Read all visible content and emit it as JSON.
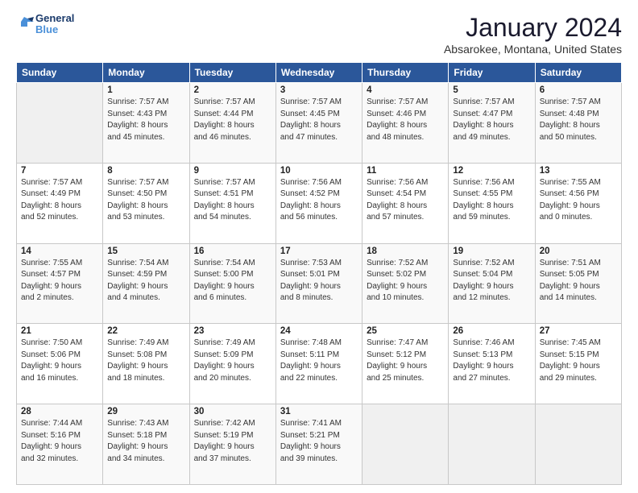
{
  "header": {
    "logo": {
      "line1": "General",
      "line2": "Blue"
    },
    "title": "January 2024",
    "location": "Absarokee, Montana, United States"
  },
  "weekdays": [
    "Sunday",
    "Monday",
    "Tuesday",
    "Wednesday",
    "Thursday",
    "Friday",
    "Saturday"
  ],
  "weeks": [
    [
      {
        "day": "",
        "info": ""
      },
      {
        "day": "1",
        "info": "Sunrise: 7:57 AM\nSunset: 4:43 PM\nDaylight: 8 hours\nand 45 minutes."
      },
      {
        "day": "2",
        "info": "Sunrise: 7:57 AM\nSunset: 4:44 PM\nDaylight: 8 hours\nand 46 minutes."
      },
      {
        "day": "3",
        "info": "Sunrise: 7:57 AM\nSunset: 4:45 PM\nDaylight: 8 hours\nand 47 minutes."
      },
      {
        "day": "4",
        "info": "Sunrise: 7:57 AM\nSunset: 4:46 PM\nDaylight: 8 hours\nand 48 minutes."
      },
      {
        "day": "5",
        "info": "Sunrise: 7:57 AM\nSunset: 4:47 PM\nDaylight: 8 hours\nand 49 minutes."
      },
      {
        "day": "6",
        "info": "Sunrise: 7:57 AM\nSunset: 4:48 PM\nDaylight: 8 hours\nand 50 minutes."
      }
    ],
    [
      {
        "day": "7",
        "info": "Sunrise: 7:57 AM\nSunset: 4:49 PM\nDaylight: 8 hours\nand 52 minutes."
      },
      {
        "day": "8",
        "info": "Sunrise: 7:57 AM\nSunset: 4:50 PM\nDaylight: 8 hours\nand 53 minutes."
      },
      {
        "day": "9",
        "info": "Sunrise: 7:57 AM\nSunset: 4:51 PM\nDaylight: 8 hours\nand 54 minutes."
      },
      {
        "day": "10",
        "info": "Sunrise: 7:56 AM\nSunset: 4:52 PM\nDaylight: 8 hours\nand 56 minutes."
      },
      {
        "day": "11",
        "info": "Sunrise: 7:56 AM\nSunset: 4:54 PM\nDaylight: 8 hours\nand 57 minutes."
      },
      {
        "day": "12",
        "info": "Sunrise: 7:56 AM\nSunset: 4:55 PM\nDaylight: 8 hours\nand 59 minutes."
      },
      {
        "day": "13",
        "info": "Sunrise: 7:55 AM\nSunset: 4:56 PM\nDaylight: 9 hours\nand 0 minutes."
      }
    ],
    [
      {
        "day": "14",
        "info": "Sunrise: 7:55 AM\nSunset: 4:57 PM\nDaylight: 9 hours\nand 2 minutes."
      },
      {
        "day": "15",
        "info": "Sunrise: 7:54 AM\nSunset: 4:59 PM\nDaylight: 9 hours\nand 4 minutes."
      },
      {
        "day": "16",
        "info": "Sunrise: 7:54 AM\nSunset: 5:00 PM\nDaylight: 9 hours\nand 6 minutes."
      },
      {
        "day": "17",
        "info": "Sunrise: 7:53 AM\nSunset: 5:01 PM\nDaylight: 9 hours\nand 8 minutes."
      },
      {
        "day": "18",
        "info": "Sunrise: 7:52 AM\nSunset: 5:02 PM\nDaylight: 9 hours\nand 10 minutes."
      },
      {
        "day": "19",
        "info": "Sunrise: 7:52 AM\nSunset: 5:04 PM\nDaylight: 9 hours\nand 12 minutes."
      },
      {
        "day": "20",
        "info": "Sunrise: 7:51 AM\nSunset: 5:05 PM\nDaylight: 9 hours\nand 14 minutes."
      }
    ],
    [
      {
        "day": "21",
        "info": "Sunrise: 7:50 AM\nSunset: 5:06 PM\nDaylight: 9 hours\nand 16 minutes."
      },
      {
        "day": "22",
        "info": "Sunrise: 7:49 AM\nSunset: 5:08 PM\nDaylight: 9 hours\nand 18 minutes."
      },
      {
        "day": "23",
        "info": "Sunrise: 7:49 AM\nSunset: 5:09 PM\nDaylight: 9 hours\nand 20 minutes."
      },
      {
        "day": "24",
        "info": "Sunrise: 7:48 AM\nSunset: 5:11 PM\nDaylight: 9 hours\nand 22 minutes."
      },
      {
        "day": "25",
        "info": "Sunrise: 7:47 AM\nSunset: 5:12 PM\nDaylight: 9 hours\nand 25 minutes."
      },
      {
        "day": "26",
        "info": "Sunrise: 7:46 AM\nSunset: 5:13 PM\nDaylight: 9 hours\nand 27 minutes."
      },
      {
        "day": "27",
        "info": "Sunrise: 7:45 AM\nSunset: 5:15 PM\nDaylight: 9 hours\nand 29 minutes."
      }
    ],
    [
      {
        "day": "28",
        "info": "Sunrise: 7:44 AM\nSunset: 5:16 PM\nDaylight: 9 hours\nand 32 minutes."
      },
      {
        "day": "29",
        "info": "Sunrise: 7:43 AM\nSunset: 5:18 PM\nDaylight: 9 hours\nand 34 minutes."
      },
      {
        "day": "30",
        "info": "Sunrise: 7:42 AM\nSunset: 5:19 PM\nDaylight: 9 hours\nand 37 minutes."
      },
      {
        "day": "31",
        "info": "Sunrise: 7:41 AM\nSunset: 5:21 PM\nDaylight: 9 hours\nand 39 minutes."
      },
      {
        "day": "",
        "info": ""
      },
      {
        "day": "",
        "info": ""
      },
      {
        "day": "",
        "info": ""
      }
    ]
  ]
}
